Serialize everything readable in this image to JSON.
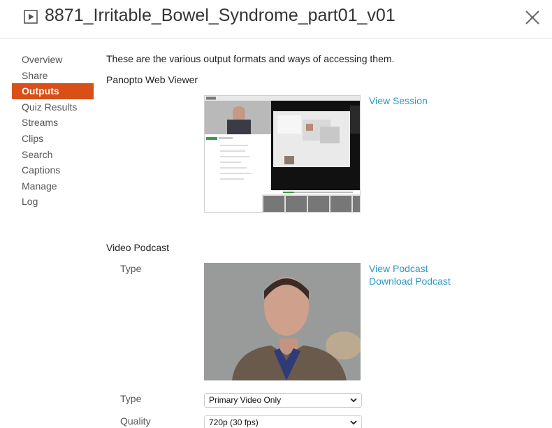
{
  "header": {
    "title": "8871_Irritable_Bowel_Syndrome_part01_v01"
  },
  "sidebar": {
    "items": [
      {
        "label": "Overview"
      },
      {
        "label": "Share"
      },
      {
        "label": "Outputs",
        "active": true
      },
      {
        "label": "Quiz Results"
      },
      {
        "label": "Streams"
      },
      {
        "label": "Clips"
      },
      {
        "label": "Search"
      },
      {
        "label": "Captions"
      },
      {
        "label": "Manage"
      },
      {
        "label": "Log"
      }
    ]
  },
  "main": {
    "intro": "These are the various output formats and ways of accessing them.",
    "web_viewer": {
      "title": "Panopto Web Viewer",
      "link": "View Session"
    },
    "video_podcast": {
      "title": "Video Podcast",
      "type_label": "Type",
      "links": [
        "View Podcast",
        "Download Podcast"
      ],
      "type_select": {
        "label": "Type",
        "value": "Primary Video Only"
      },
      "quality_select": {
        "label": "Quality",
        "value": "720p (30 fps)"
      }
    }
  },
  "colors": {
    "accent": "#d84f17",
    "link": "#2a98c9"
  },
  "icons": {
    "title": "play-box-icon",
    "close": "close-icon",
    "select": "chevron-down-icon"
  }
}
